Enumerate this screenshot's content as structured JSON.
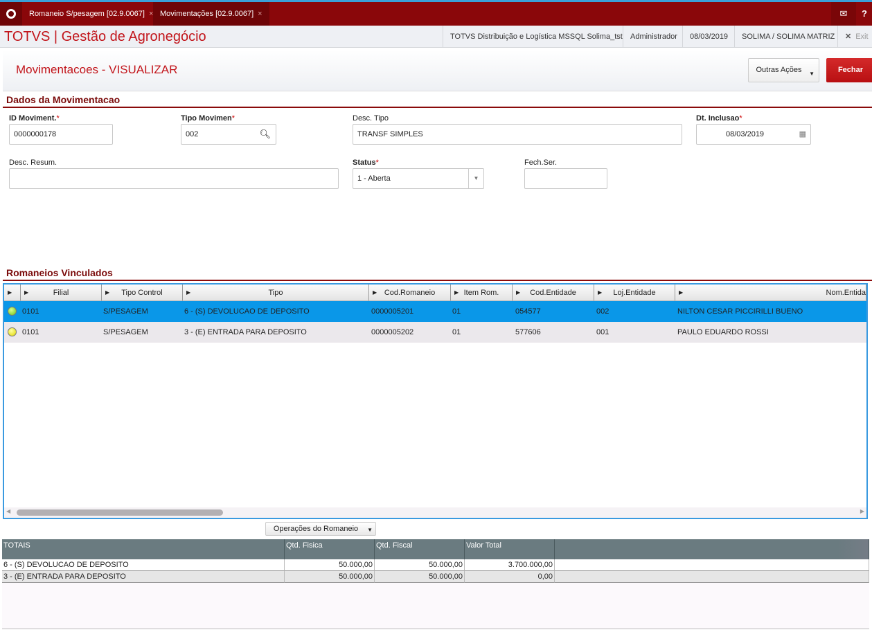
{
  "tabs": [
    {
      "label": "Romaneio S/pesagem [02.9.0067]"
    },
    {
      "label": "Movimentações [02.9.0067]"
    }
  ],
  "header": {
    "app_title": "TOTVS | Gestão de Agronegócio",
    "environment": "TOTVS Distribuição e Logística MSSQL Solima_tst",
    "user": "Administrador",
    "date": "08/03/2019",
    "company": "SOLIMA / SOLIMA MATRIZ",
    "exit": "Exit"
  },
  "page": {
    "title": "Movimentacoes - VISUALIZAR",
    "other_actions": "Outras Ações",
    "close": "Fechar"
  },
  "form": {
    "section": "Dados da Movimentacao",
    "id_label": "ID Moviment.",
    "id_value": "0000000178",
    "tipo_label": "Tipo Movimen",
    "tipo_value": "002",
    "desc_tipo_label": "Desc. Tipo",
    "desc_tipo_value": "TRANSF SIMPLES",
    "dt_label": "Dt. Inclusao",
    "dt_value": "08/03/2019",
    "desc_resum_label": "Desc. Resum.",
    "desc_resum_value": "",
    "status_label": "Status",
    "status_value": "1 - Aberta",
    "fech_label": "Fech.Ser.",
    "fech_value": ""
  },
  "grid": {
    "section": "Romaneios Vinculados",
    "columns": [
      "Filial",
      "Tipo Control",
      "Tipo",
      "Cod.Romaneio",
      "Item Rom.",
      "Cod.Entidade",
      "Loj.Entidade",
      "Nom.Entida"
    ],
    "rows": [
      {
        "status": "green",
        "cells": [
          "0101",
          "S/PESAGEM",
          "6 - (S) DEVOLUCAO DE DEPOSITO",
          "0000005201",
          "01",
          "054577",
          "002",
          "NILTON CESAR PICCIRILLI BUENO"
        ]
      },
      {
        "status": "yellow",
        "cells": [
          "0101",
          "S/PESAGEM",
          "3 - (E) ENTRADA PARA DEPOSITO",
          "0000005202",
          "01",
          "577606",
          "001",
          "PAULO EDUARDO ROSSI"
        ]
      }
    ]
  },
  "operations_button": "Operações do Romaneio",
  "totals": {
    "columns": [
      "TOTAIS",
      "Qtd. Fisica",
      "Qtd. Fiscal",
      "Valor Total"
    ],
    "rows": [
      [
        "6 - (S) DEVOLUCAO DE DEPOSITO",
        "50.000,00",
        "50.000,00",
        "3.700.000,00"
      ],
      [
        "3 - (E) ENTRADA PARA DEPOSITO",
        "50.000,00",
        "50.000,00",
        "0,00"
      ]
    ]
  },
  "colors": {
    "brand": "#8a070a",
    "accent": "#c2151b",
    "selection": "#0a97e8"
  }
}
